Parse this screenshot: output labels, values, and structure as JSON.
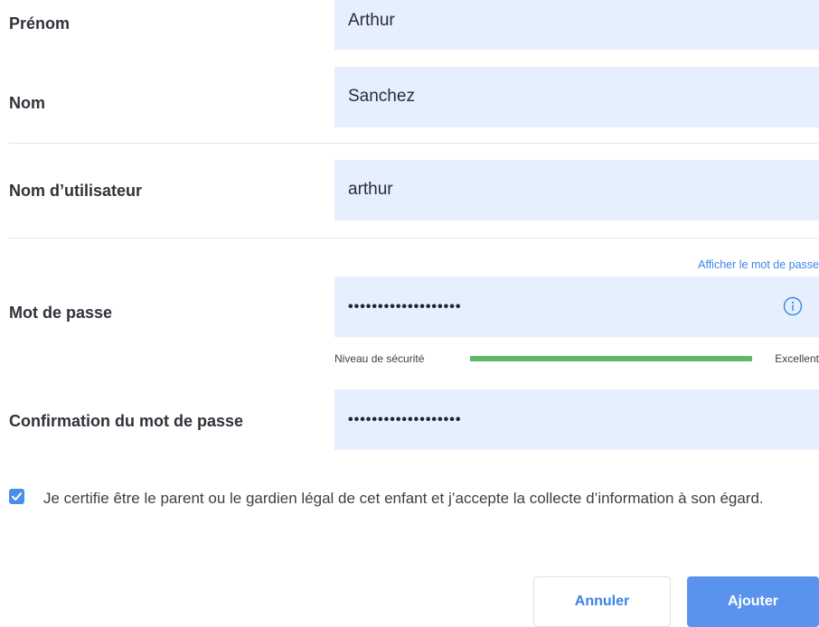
{
  "form": {
    "first_name": {
      "label": "Prénom",
      "value": "Arthur"
    },
    "last_name": {
      "label": "Nom",
      "value": "Sanchez"
    },
    "username": {
      "label": "Nom d’utilisateur",
      "value": "arthur"
    },
    "password": {
      "label": "Mot de passe",
      "value": "•••••••••••••••••••",
      "show_password_link": "Afficher le mot de passe",
      "info_icon": "info-circle-icon",
      "strength_label": "Niveau de sécurité",
      "strength_value": "Excellent",
      "strength_fraction": 1.0,
      "strength_color": "#5fb86a"
    },
    "password_confirm": {
      "label": "Confirmation du mot de passe",
      "value": "•••••••••••••••••••"
    },
    "consent": {
      "checked": true,
      "text": "Je certifie être le parent ou le gardien légal de cet enfant et j’accepte la collecte d’information à son égard."
    }
  },
  "actions": {
    "cancel_label": "Annuler",
    "add_label": "Ajouter"
  },
  "colors": {
    "field_bg": "#e6effd",
    "accent": "#5a93ee",
    "link": "#3a86e8"
  }
}
